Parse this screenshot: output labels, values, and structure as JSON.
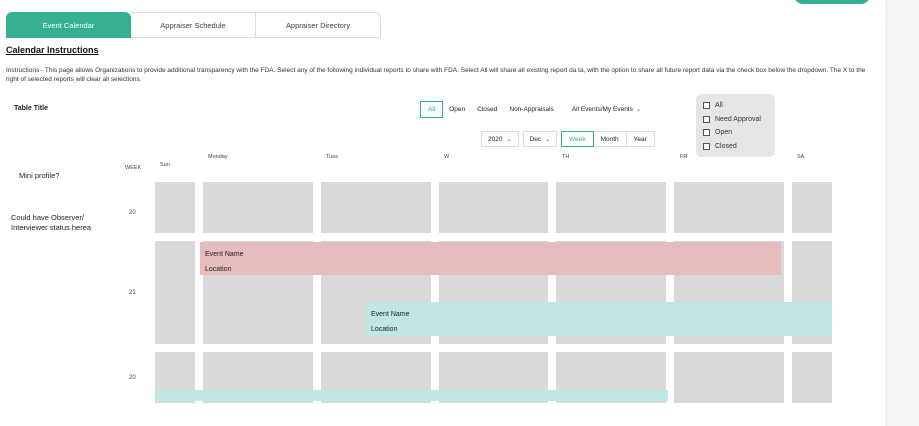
{
  "tabs": [
    {
      "label": "Event Calendar",
      "active": true
    },
    {
      "label": "Appraiser Schedule",
      "active": false
    },
    {
      "label": "Appraiser Directory",
      "active": false
    }
  ],
  "instructions": {
    "title": "Calendar Instructions",
    "text": "Instructions - This page allows Organizations to provide additional transparency with the FDA. Select any of the following individual reports to share with FDA. Select All will share all existing report da ta, with the option to share all future report data via the check box below the dropdown. The X to the right of selected reports will clear all selections."
  },
  "table_title": "Table Title",
  "filters": {
    "all": "All",
    "open": "Open",
    "closed": "Closed",
    "non_appraisals": "Non-Appraisals",
    "events_dropdown": "All Events/My Events",
    "active": "All"
  },
  "checklist": [
    {
      "label": "All",
      "checked": false
    },
    {
      "label": "Need Approval",
      "checked": false
    },
    {
      "label": "Open",
      "checked": false
    },
    {
      "label": "Closed",
      "checked": false
    }
  ],
  "date_controls": {
    "year": "2020",
    "month": "Dec",
    "views": [
      "Week",
      "Month",
      "Year"
    ],
    "active_view": "Week"
  },
  "calendar": {
    "week_header": "WEEK",
    "days": [
      "Sun",
      "Monday",
      "Tues",
      "W",
      "TH",
      "FR",
      "SA"
    ],
    "weeks": [
      "20",
      "21",
      "20"
    ]
  },
  "side_labels": {
    "mini_profile": "Mini profile?",
    "status": "Could have Observer/ Interviewer status herea"
  },
  "events": [
    {
      "name": "Event Name",
      "location": "Location",
      "color": "#e6bcbc"
    },
    {
      "name": "Event Name",
      "location": "Location",
      "color": "#bfe7e3"
    }
  ],
  "colors": {
    "accent": "#35b090",
    "cell": "#d9d9d9"
  },
  "icons": {
    "dropdown": "chevron-down-icon"
  }
}
